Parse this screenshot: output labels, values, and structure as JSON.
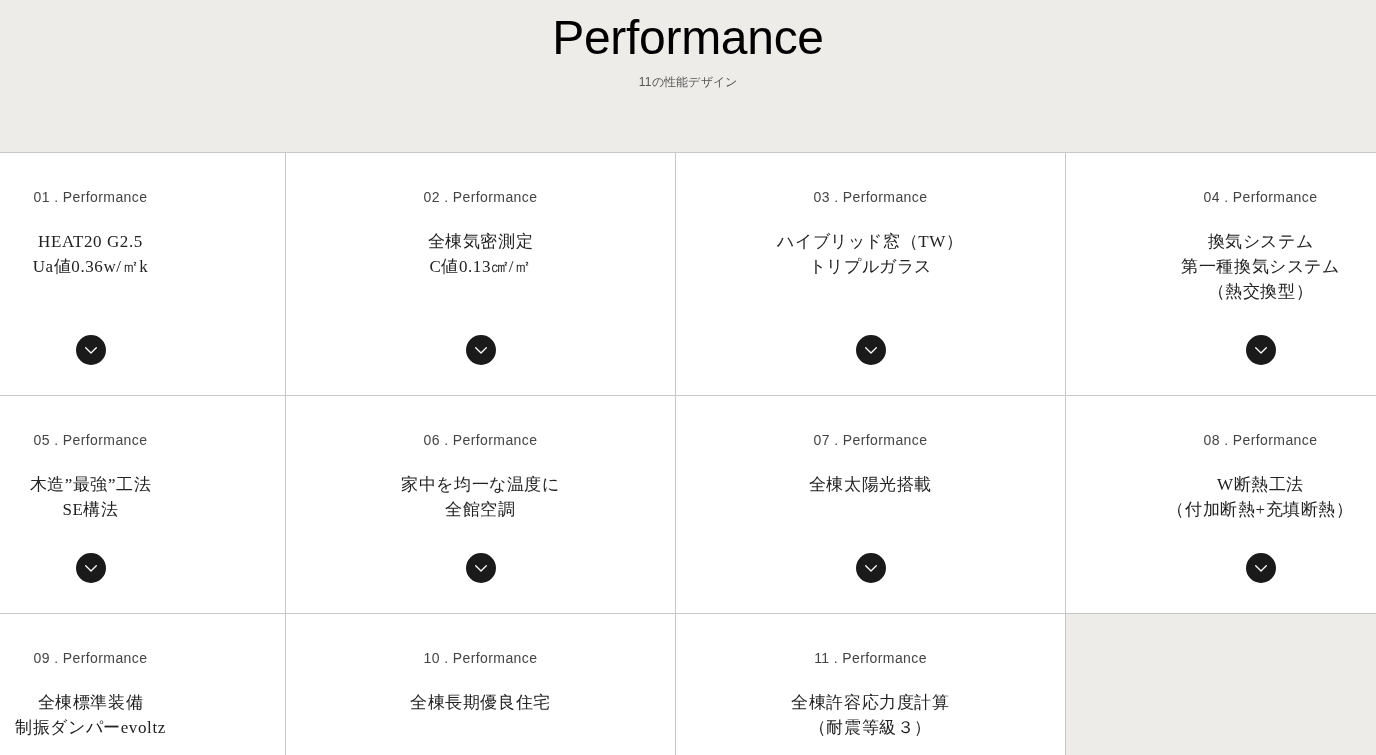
{
  "header": {
    "title": "Performance",
    "subtitle": "11の性能デザイン"
  },
  "items": [
    {
      "label": "01 . Performance",
      "lines": [
        "HEAT20 G2.5",
        "Ua値0.36w/㎡k"
      ],
      "toggle": true
    },
    {
      "label": "02 . Performance",
      "lines": [
        "全棟気密測定",
        "C値0.13㎠/㎡"
      ],
      "toggle": true
    },
    {
      "label": "03 . Performance",
      "lines": [
        "ハイブリッド窓（TW）",
        "トリプルガラス"
      ],
      "toggle": true
    },
    {
      "label": "04 . Performance",
      "lines": [
        "換気システム",
        "第一種換気システム",
        "（熱交換型）"
      ],
      "toggle": true
    },
    {
      "label": "05 . Performance",
      "lines": [
        "木造”最強”工法",
        "SE構法"
      ],
      "toggle": true
    },
    {
      "label": "06 . Performance",
      "lines": [
        "家中を均一な温度に",
        "全館空調"
      ],
      "toggle": true
    },
    {
      "label": "07 . Performance",
      "lines": [
        "全棟太陽光搭載"
      ],
      "toggle": true
    },
    {
      "label": "08 . Performance",
      "lines": [
        "W断熱工法",
        "（付加断熱+充填断熱）"
      ],
      "toggle": true
    },
    {
      "label": "09 . Performance",
      "lines": [
        "全棟標準装備",
        "制振ダンパーevoltz"
      ]
    },
    {
      "label": "10 . Performance",
      "lines": [
        "全棟長期優良住宅"
      ]
    },
    {
      "label": "11 . Performance",
      "lines": [
        "全棟許容応力度計算",
        "（耐震等級３）"
      ]
    }
  ]
}
